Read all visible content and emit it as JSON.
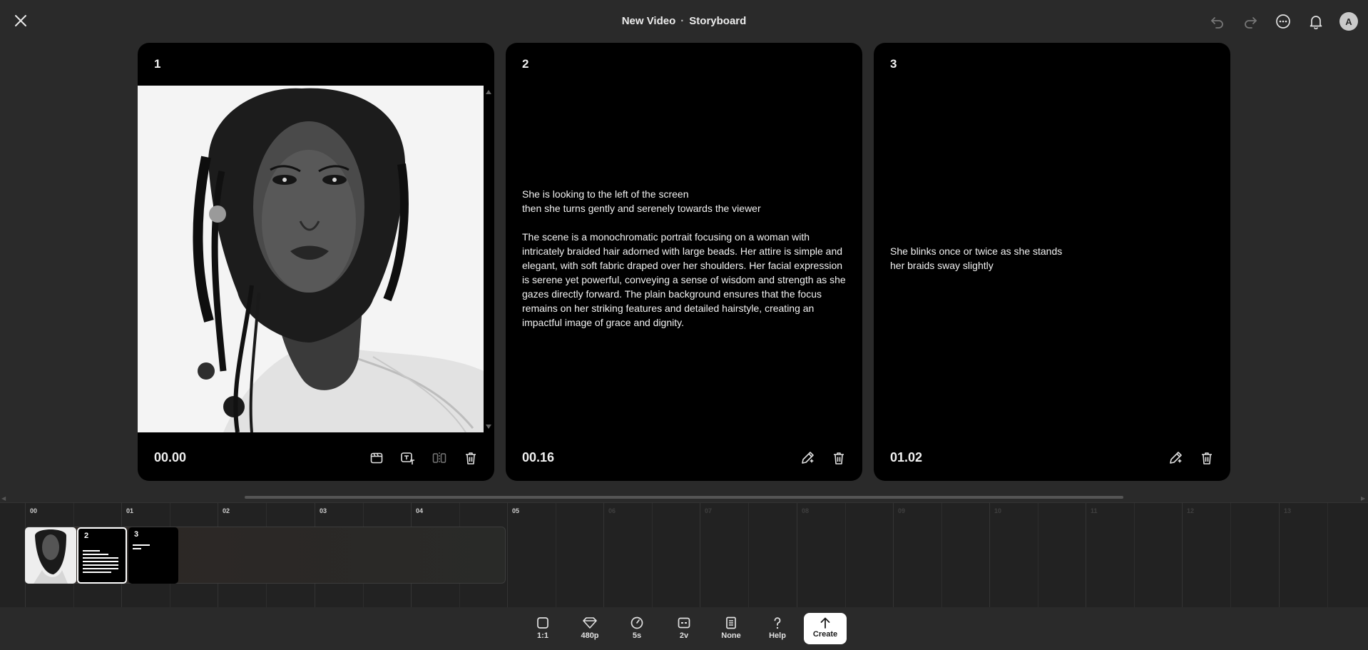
{
  "header": {
    "title": "New Video",
    "separator": "·",
    "subtitle": "Storyboard",
    "avatar_letter": "A"
  },
  "icons": {
    "close": "close-icon",
    "undo": "undo-icon",
    "redo": "redo-icon",
    "more": "more-icon",
    "notifications": "bell-icon"
  },
  "cards": [
    {
      "number": "1",
      "time": "00.00",
      "has_image": true,
      "actions": [
        "storyboard-icon",
        "text-edit-icon",
        "mirror-icon",
        "trash-icon"
      ]
    },
    {
      "number": "2",
      "time": "00.16",
      "text": "She is looking to the left of the screen\nthen she turns gently and serenely towards the viewer\n\nThe scene is a monochromatic portrait focusing on a woman with intricately braided hair adorned with large beads. Her attire is simple and elegant, with soft fabric draped over her shoulders. Her facial expression is serene yet powerful, conveying a sense of wisdom and strength as she gazes directly forward. The plain background ensures that the focus remains on her striking features and detailed hairstyle, creating an impactful image of grace and dignity.",
      "actions": [
        "pen-icon",
        "trash-icon"
      ]
    },
    {
      "number": "3",
      "time": "01.02",
      "text": "She blinks once or twice as she stands\nher braids sway slightly",
      "actions": [
        "pen-icon",
        "trash-icon"
      ]
    }
  ],
  "timeline": {
    "ticks": [
      "00",
      "01",
      "02",
      "03",
      "04",
      "05",
      "06",
      "07",
      "08",
      "09",
      "10",
      "11",
      "12",
      "13"
    ],
    "clips": [
      {
        "number": "",
        "kind": "image"
      },
      {
        "number": "2",
        "kind": "text",
        "selected": true
      },
      {
        "number": "3",
        "kind": "text",
        "selected": false
      }
    ]
  },
  "toolbar": {
    "aspect_label": "1:1",
    "quality_label": "480p",
    "duration_label": "5s",
    "variations_label": "2v",
    "style_label": "None",
    "help_label": "Help",
    "create_label": "Create"
  },
  "colors": {
    "background": "#2a2a2a",
    "card": "#000000",
    "accent_button": "#ffffff"
  }
}
